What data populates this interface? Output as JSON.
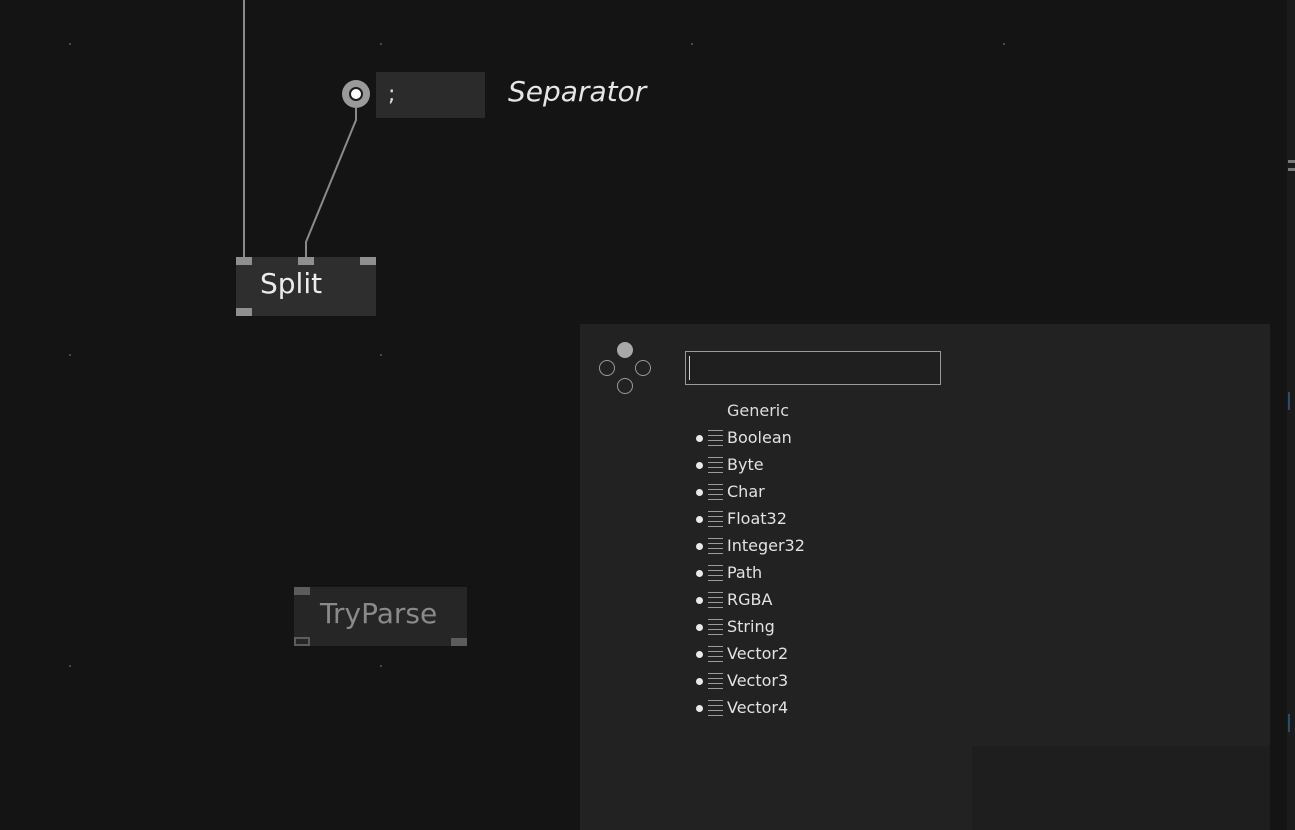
{
  "iobox": {
    "value": ";",
    "label": "Separator"
  },
  "nodes": {
    "split": "Split",
    "tryparse": "TryParse"
  },
  "browser": {
    "search": {
      "value": "",
      "placeholder": ""
    },
    "category": "Generic",
    "items": [
      "Boolean",
      "Byte",
      "Char",
      "Float32",
      "Integer32",
      "Path",
      "RGBA",
      "String",
      "Vector2",
      "Vector3",
      "Vector4"
    ]
  }
}
